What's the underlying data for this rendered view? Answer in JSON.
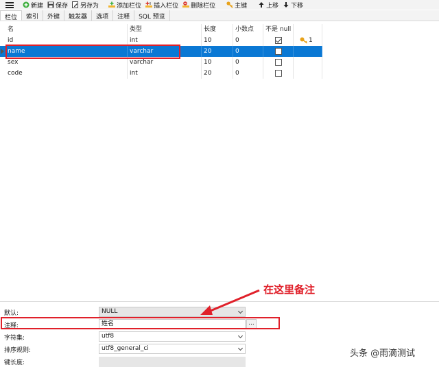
{
  "toolbar": {
    "new": "新建",
    "save": "保存",
    "save_as": "另存为",
    "add_field": "添加栏位",
    "insert_field": "插入栏位",
    "delete_field": "删除栏位",
    "primary_key": "主键",
    "move_up": "上移",
    "move_down": "下移"
  },
  "tabs": [
    "栏位",
    "索引",
    "外键",
    "触发器",
    "选项",
    "注释",
    "SQL 预览"
  ],
  "grid": {
    "headers": {
      "name": "名",
      "type": "类型",
      "length": "长度",
      "decimals": "小数点",
      "not_null": "不是 null"
    },
    "rows": [
      {
        "name": "id",
        "type": "int",
        "length": "10",
        "decimals": "0",
        "not_null": true,
        "key": "1"
      },
      {
        "name": "name",
        "type": "varchar",
        "length": "20",
        "decimals": "0",
        "not_null": false,
        "key": ""
      },
      {
        "name": "sex",
        "type": "varchar",
        "length": "10",
        "decimals": "0",
        "not_null": false,
        "key": ""
      },
      {
        "name": "code",
        "type": "int",
        "length": "20",
        "decimals": "0",
        "not_null": false,
        "key": ""
      }
    ]
  },
  "props": {
    "default_label": "默认:",
    "default_value": "NULL",
    "comment_label": "注释:",
    "comment_value": "姓名",
    "comment_button": "...",
    "charset_label": "字符集:",
    "charset_value": "utf8",
    "collation_label": "排序规则:",
    "collation_value": "utf8_general_ci",
    "key_length_label": "键长度:"
  },
  "annotation": "在这里备注",
  "watermark": "头条 @雨滴测试",
  "colors": {
    "selection": "#0a78d4",
    "highlight": "#e0202a"
  }
}
